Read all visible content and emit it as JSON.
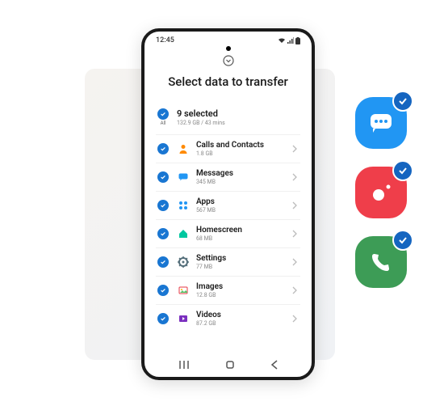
{
  "statusBar": {
    "time": "12:45"
  },
  "screen": {
    "title": "Select data to transfer",
    "summary": {
      "allLabel": "All",
      "title": "9 selected",
      "sub": "132.9 GB / 43 mins"
    },
    "items": [
      {
        "label": "Calls and Contacts",
        "sub": "1.8 GB"
      },
      {
        "label": "Messages",
        "sub": "345 MB"
      },
      {
        "label": "Apps",
        "sub": "567 MB"
      },
      {
        "label": "Homescreen",
        "sub": "68 MB"
      },
      {
        "label": "Settings",
        "sub": "77 MB"
      },
      {
        "label": "Images",
        "sub": "12.8 GB"
      },
      {
        "label": "Videos",
        "sub": "87.2 GB"
      }
    ]
  }
}
